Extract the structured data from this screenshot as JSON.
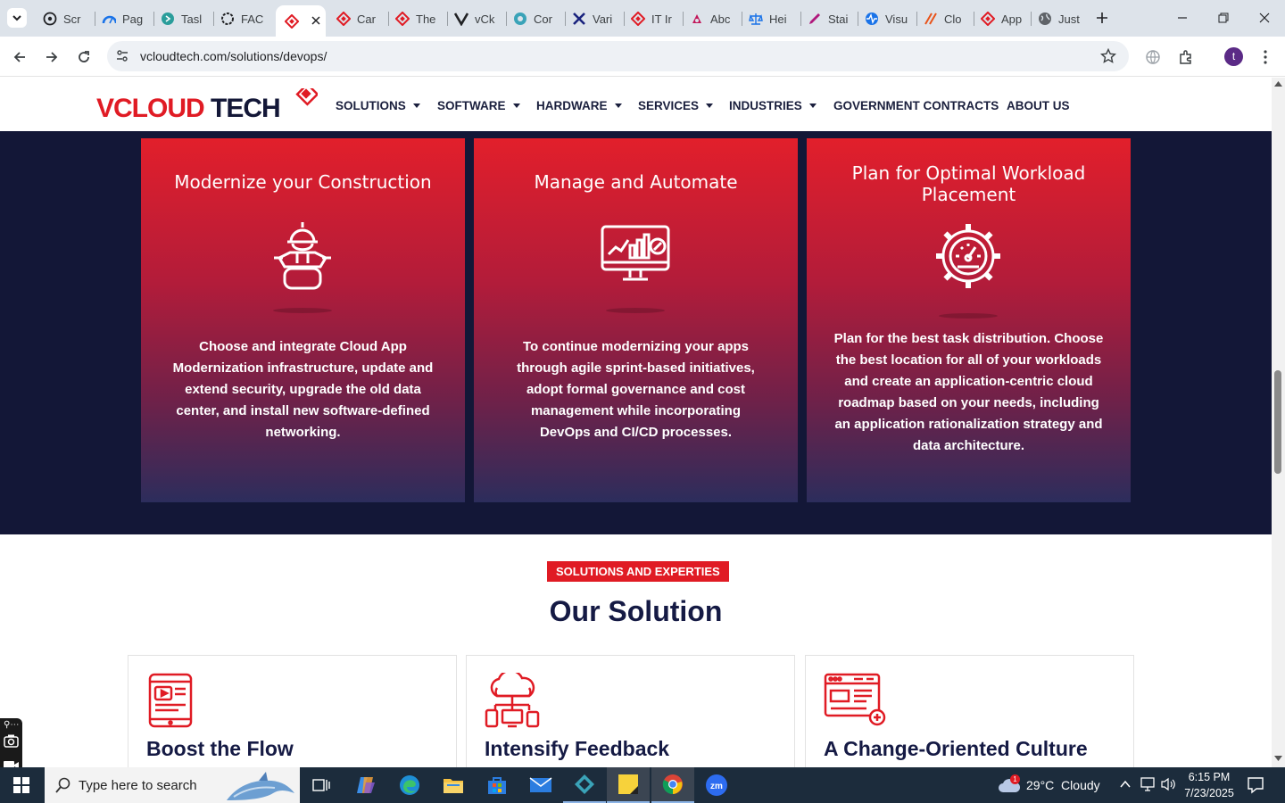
{
  "browser": {
    "tabs": [
      {
        "label": "Scr",
        "icon": "chatgpt-icon"
      },
      {
        "label": "Pag",
        "icon": "speed-icon"
      },
      {
        "label": "Tasl",
        "icon": "task-icon"
      },
      {
        "label": "FAC",
        "icon": "openai-icon"
      },
      {
        "label": "",
        "icon": "vcloud-icon",
        "active": true
      },
      {
        "label": "Car",
        "icon": "vcloud-icon"
      },
      {
        "label": "The",
        "icon": "vcloud-icon"
      },
      {
        "label": "vCk",
        "icon": "v-icon"
      },
      {
        "label": "Cor",
        "icon": "teal-icon"
      },
      {
        "label": "Vari",
        "icon": "x-icon"
      },
      {
        "label": "IT Ir",
        "icon": "vcloud-icon"
      },
      {
        "label": "Abc",
        "icon": "pink-icon"
      },
      {
        "label": "Hei",
        "icon": "scale-icon"
      },
      {
        "label": "Stai",
        "icon": "pen-icon"
      },
      {
        "label": "Visu",
        "icon": "pulse-icon"
      },
      {
        "label": "Clo",
        "icon": "slash-icon"
      },
      {
        "label": "App",
        "icon": "vcloud-icon"
      },
      {
        "label": "Just",
        "icon": "globe-icon"
      }
    ],
    "url": "vcloudtech.com/solutions/devops/",
    "profile_initial": "t"
  },
  "site": {
    "logo_text": "VCLOUD TECH",
    "nav": [
      {
        "label": "SOLUTIONS",
        "dropdown": true
      },
      {
        "label": "SOFTWARE",
        "dropdown": true
      },
      {
        "label": "HARDWARE",
        "dropdown": true
      },
      {
        "label": "SERVICES",
        "dropdown": true
      },
      {
        "label": "INDUSTRIES",
        "dropdown": true
      },
      {
        "label": "GOVERNMENT CONTRACTS",
        "dropdown": false
      },
      {
        "label": "ABOUT US",
        "dropdown": false
      }
    ],
    "cards": [
      {
        "title": "Modernize your Construction",
        "icon": "construction-worker-icon",
        "text": "Choose and integrate Cloud App Modernization infrastructure, update and extend security, upgrade the old data center, and install new software-defined networking."
      },
      {
        "title": "Manage and Automate",
        "icon": "monitor-chart-icon",
        "text": "To continue modernizing your apps through agile sprint-based initiatives, adopt formal governance and cost management while incorporating DevOps and CI/CD processes."
      },
      {
        "title": "Plan for Optimal Workload Placement",
        "icon": "gear-gauge-icon",
        "text": "Plan for the best task distribution. Choose the best location for all of your workloads and create an application-centric cloud roadmap based on your needs, including an application rationalization strategy and data architecture."
      }
    ],
    "section_badge": "SOLUTIONS AND EXPERTIES",
    "section_title": "Our Solution",
    "solutions": [
      {
        "title": "Boost the Flow",
        "icon": "mobile-video-icon"
      },
      {
        "title": "Intensify Feedback",
        "icon": "cloud-network-icon"
      },
      {
        "title": "A Change-Oriented Culture",
        "icon": "browser-add-icon"
      }
    ]
  },
  "taskbar": {
    "search_placeholder": "Type here to search",
    "weather": "29°C  Cloudy",
    "weather_badge": "1",
    "time": "6:15 PM",
    "date": "7/23/2025"
  },
  "colors": {
    "accent_red": "#e01b24",
    "navy": "#131737",
    "title_navy": "#151a44"
  }
}
